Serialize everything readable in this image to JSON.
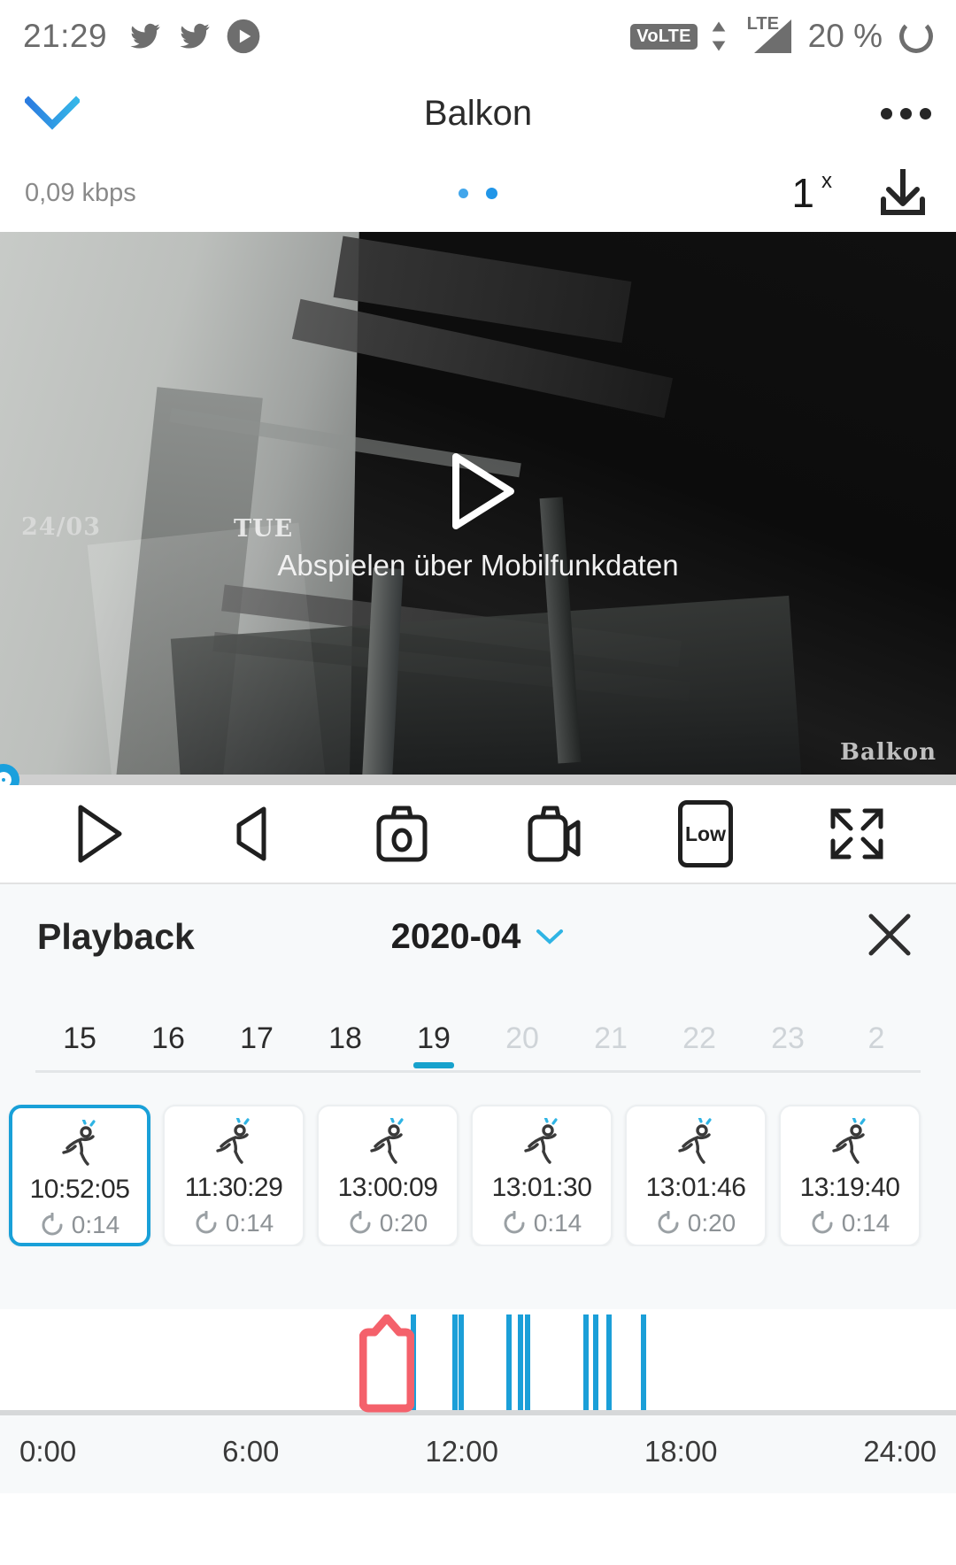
{
  "statusbar": {
    "time": "21:29",
    "icons": [
      "twitter-icon",
      "twitter-icon",
      "play-circle-icon"
    ],
    "volte": "VoLTE",
    "network": "LTE",
    "battery": "20 %"
  },
  "titlebar": {
    "back_icon": "chevron-down-icon",
    "title": "Balkon",
    "more_icon": "more-horizontal-icon"
  },
  "subbar": {
    "bitrate": "0,09 kbps",
    "page_dots": 2,
    "active_dot": 1,
    "speed_label": "1",
    "speed_sup": "x",
    "download_icon": "download-icon"
  },
  "video": {
    "timestamp": "24/03",
    "weekday": "TUE",
    "camera_name": "Balkon",
    "overlay_caption": "Abspielen über Mobilfunkdaten",
    "play_icon": "play-triangle-icon",
    "progress_percent": 0
  },
  "controls": [
    {
      "name": "play-button",
      "icon": "play-icon"
    },
    {
      "name": "mute-button",
      "icon": "speaker-icon"
    },
    {
      "name": "snapshot-button",
      "icon": "camera-icon"
    },
    {
      "name": "record-button",
      "icon": "video-camera-icon"
    },
    {
      "name": "quality-button",
      "icon": "quality-badge",
      "label": "Low"
    },
    {
      "name": "fullscreen-button",
      "icon": "expand-icon"
    }
  ],
  "playback": {
    "title": "Playback",
    "month": "2020-04",
    "month_chevron": "chevron-down-icon",
    "close_icon": "close-icon",
    "days": [
      {
        "label": "15",
        "state": "available"
      },
      {
        "label": "16",
        "state": "available"
      },
      {
        "label": "17",
        "state": "available"
      },
      {
        "label": "18",
        "state": "available"
      },
      {
        "label": "19",
        "state": "active"
      },
      {
        "label": "20",
        "state": "disabled"
      },
      {
        "label": "21",
        "state": "disabled"
      },
      {
        "label": "22",
        "state": "disabled"
      },
      {
        "label": "23",
        "state": "disabled"
      },
      {
        "label": "2",
        "state": "disabled"
      }
    ],
    "events": [
      {
        "time": "10:52:05",
        "duration": "0:14",
        "icon": "motion-running-icon",
        "selected": true
      },
      {
        "time": "11:30:29",
        "duration": "0:14",
        "icon": "motion-running-icon",
        "selected": false
      },
      {
        "time": "13:00:09",
        "duration": "0:20",
        "icon": "motion-running-icon",
        "selected": false
      },
      {
        "time": "13:01:30",
        "duration": "0:14",
        "icon": "motion-running-icon",
        "selected": false
      },
      {
        "time": "13:01:46",
        "duration": "0:20",
        "icon": "motion-running-icon",
        "selected": false
      },
      {
        "time": "13:19:40",
        "duration": "0:14",
        "icon": "motion-running-icon",
        "selected": false
      }
    ],
    "timeline": {
      "labels": [
        "0:00",
        "6:00",
        "12:00",
        "18:00",
        "24:00"
      ],
      "cursor_position_pct": 40.5,
      "marks_pct": [
        43.0,
        47.3,
        48.0,
        53.0,
        54.2,
        54.9,
        61.0,
        62.0,
        63.4,
        67.0
      ],
      "mark_color": "#1b9fd8",
      "cursor_color": "#f4616b"
    }
  },
  "colors": {
    "accent": "#19a0d8",
    "panel_bg": "#f7f9fa",
    "text": "#262626"
  }
}
